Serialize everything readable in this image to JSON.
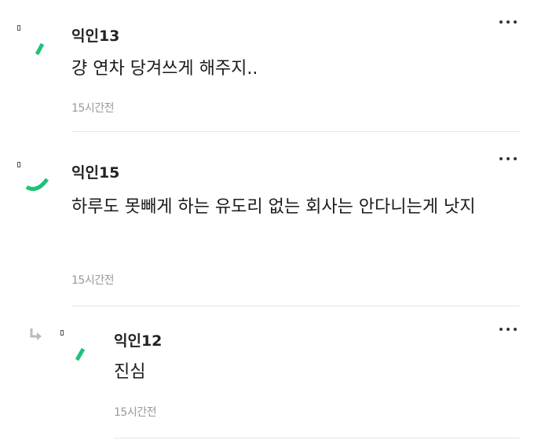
{
  "comments": [
    {
      "author": "익인13",
      "text": "걍 연차 당겨쓰게 해주지..",
      "time": "15시간전",
      "more_icon": "more-horizontal-icon",
      "accent": "#1fc27a"
    },
    {
      "author": "익인15",
      "text": "하루도 못빼게 하는 유도리 없는 회사는 안다니는게 낫지",
      "time": "15시간전",
      "more_icon": "more-horizontal-icon",
      "accent": "#1fc27a"
    },
    {
      "author": "익인12",
      "text": "진심",
      "time": "15시간전",
      "more_icon": "more-horizontal-icon",
      "accent": "#1fc27a",
      "is_reply": true,
      "reply_icon": "reply-arrow-icon"
    }
  ]
}
